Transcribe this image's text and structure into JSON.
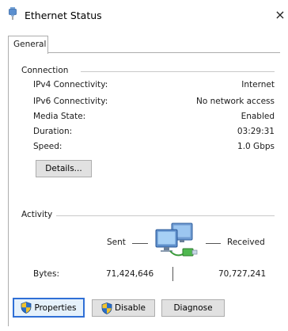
{
  "window": {
    "title": "Ethernet Status",
    "close_glyph": "×",
    "icon": "ethernet-icon"
  },
  "tabs": [
    {
      "label": "General"
    }
  ],
  "connection": {
    "heading": "Connection",
    "rows": [
      {
        "label": "IPv4 Connectivity:",
        "value": "Internet"
      },
      {
        "label": "IPv6 Connectivity:",
        "value": "No network access"
      },
      {
        "label": "Media State:",
        "value": "Enabled"
      },
      {
        "label": "Duration:",
        "value": "03:29:31"
      },
      {
        "label": "Speed:",
        "value": "1.0 Gbps"
      }
    ],
    "details_button": "Details..."
  },
  "activity": {
    "heading": "Activity",
    "sent_label": "Sent",
    "received_label": "Received",
    "bytes_label": "Bytes:",
    "bytes_sent": "71,424,646",
    "bytes_received": "70,727,241"
  },
  "buttons": {
    "properties": "Properties",
    "disable": "Disable",
    "diagnose": "Diagnose"
  },
  "colors": {
    "accent": "#2f6fd6",
    "shield_blue": "#2a6ec9",
    "shield_yellow": "#f2c32c"
  }
}
